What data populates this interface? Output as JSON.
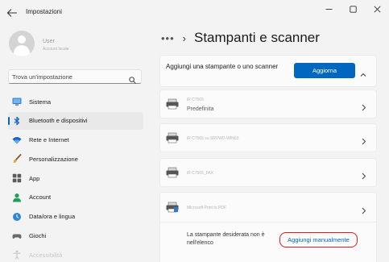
{
  "window": {
    "app_title": "Impostazioni"
  },
  "user": {
    "name": "User",
    "subtitle": "Account locale"
  },
  "search": {
    "placeholder": "Trova un'impostazione"
  },
  "nav": {
    "items": [
      {
        "label": "Sistema",
        "icon": "monitor-icon"
      },
      {
        "label": "Bluetooth e dispositivi",
        "icon": "bluetooth-icon"
      },
      {
        "label": "Rete e Internet",
        "icon": "wifi-icon"
      },
      {
        "label": "Personalizzazione",
        "icon": "brush-icon"
      },
      {
        "label": "App",
        "icon": "apps-icon"
      },
      {
        "label": "Account",
        "icon": "account-icon"
      },
      {
        "label": "Data/ora e lingua",
        "icon": "globe-clock-icon"
      },
      {
        "label": "Giochi",
        "icon": "gamepad-icon"
      },
      {
        "label": "Accessibilità",
        "icon": "accessibility-icon"
      }
    ],
    "selected": "Bluetooth e dispositivi"
  },
  "breadcrumb": {
    "overflow": "•••",
    "separator": "›",
    "title": "Stampanti e scanner"
  },
  "add_card": {
    "text": "Aggiungi una stampante o uno scanner",
    "button_label": "Aggiorna"
  },
  "printers": [
    {
      "name": "iR C7565",
      "subtitle": "Predefinita"
    },
    {
      "name": "iR C7565 su SRVWD-WIN03",
      "subtitle": ""
    },
    {
      "name": "iR C7565_FAX",
      "subtitle": ""
    },
    {
      "name": "Microsoft Print to PDF",
      "subtitle": ""
    }
  ],
  "manual": {
    "text": "La stampante desiderata non è nell'elenco",
    "link_label": "Aggiungi manualmente"
  },
  "colors": {
    "accent": "#0067c0",
    "highlight_outline": "#e01b1b",
    "background": "#f3f3f3",
    "card": "#fbfbfb"
  }
}
